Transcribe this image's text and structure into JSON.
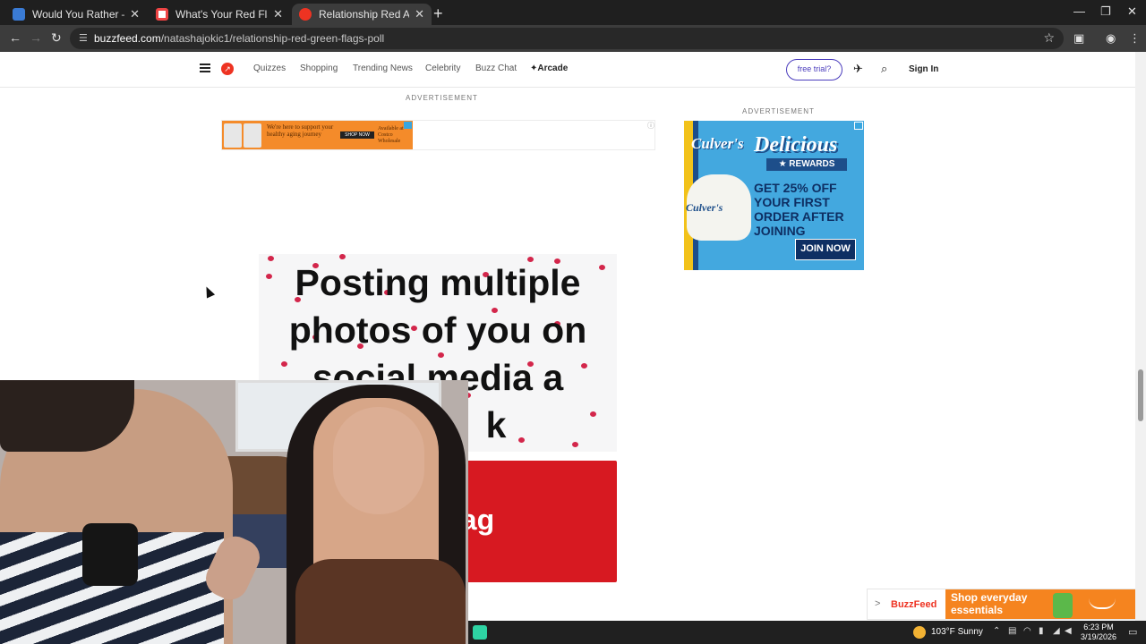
{
  "browser": {
    "tabs": [
      {
        "label": "Would You Rather — Play the Q",
        "color": "#3a7bd5"
      },
      {
        "label": "What's Your Red Flag Quiz - wit",
        "color": "#e44"
      },
      {
        "label": "Relationship Red And Green Fla",
        "color": "#e32",
        "active": true
      }
    ],
    "url_domain": "buzzfeed.com",
    "url_path": "/natashajokic1/relationship-red-green-flags-poll"
  },
  "site_nav": {
    "links": [
      "Quizzes",
      "Shopping",
      "Trending News",
      "Celebrity",
      "Buzz Chat"
    ],
    "arcade": "✦Arcade",
    "trial": "free trial?",
    "signin": "Sign In"
  },
  "ads": {
    "label": "ADVERTISEMENT",
    "banner_text": "We're here to support your healthy aging journey",
    "banner_button": "SHOP NOW",
    "banner_side": "Available at Costco Wholesale",
    "side_brand": "Culver's",
    "side_headline": "Delicious",
    "side_rewards": "★ REWARDS",
    "side_offer": "GET 25% OFF YOUR FIRST ORDER AFTER JOINING",
    "side_button": "JOIN NOW"
  },
  "poll": {
    "question": "Posting multiple photos of you on social media a",
    "question_end": "k",
    "answer": "Red flag"
  },
  "promo": {
    "brand": "BuzzFeed",
    "text": "Shop everyday essentials"
  },
  "taskbar": {
    "weather": "103°F  Sunny",
    "time": "6:23 PM",
    "date": "3/19/2026"
  }
}
